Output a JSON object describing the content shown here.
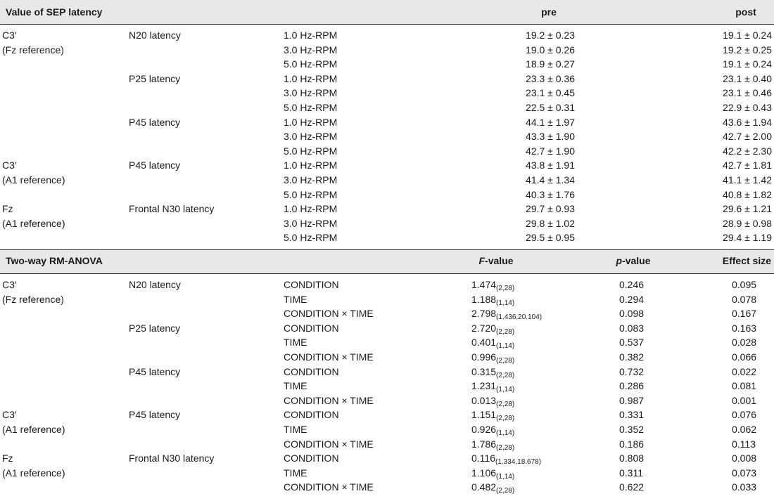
{
  "sep": {
    "title": "Value of SEP latency",
    "col_pre": "pre",
    "col_post": "post",
    "groups": [
      {
        "site1": "C3′",
        "site2": "(Fz reference)",
        "components": [
          {
            "name": "N20 latency",
            "rows": [
              {
                "freq": "1.0 Hz-RPM",
                "pre": "19.2 ± 0.23",
                "post": "19.1 ± 0.24"
              },
              {
                "freq": "3.0 Hz-RPM",
                "pre": "19.0 ± 0.26",
                "post": "19.2 ± 0.25"
              },
              {
                "freq": "5.0 Hz-RPM",
                "pre": "18.9 ± 0.27",
                "post": "19.1 ± 0.24"
              }
            ]
          },
          {
            "name": "P25 latency",
            "rows": [
              {
                "freq": "1.0 Hz-RPM",
                "pre": "23.3 ± 0.36",
                "post": "23.1 ± 0.40"
              },
              {
                "freq": "3.0 Hz-RPM",
                "pre": "23.1 ± 0.45",
                "post": "23.1 ± 0.46"
              },
              {
                "freq": "5.0 Hz-RPM",
                "pre": "22.5 ± 0.31",
                "post": "22.9 ± 0.43"
              }
            ]
          },
          {
            "name": "P45 latency",
            "rows": [
              {
                "freq": "1.0 Hz-RPM",
                "pre": "44.1 ± 1.97",
                "post": "43.6 ± 1.94"
              },
              {
                "freq": "3.0 Hz-RPM",
                "pre": "43.3 ± 1.90",
                "post": "42.7 ± 2.00"
              },
              {
                "freq": "5.0 Hz-RPM",
                "pre": "42.7 ± 1.90",
                "post": "42.2 ± 2.30"
              }
            ]
          }
        ]
      },
      {
        "site1": "C3′",
        "site2": "(A1 reference)",
        "components": [
          {
            "name": "P45 latency",
            "rows": [
              {
                "freq": "1.0 Hz-RPM",
                "pre": "43.8 ± 1.91",
                "post": "42.7 ± 1.81"
              },
              {
                "freq": "3.0 Hz-RPM",
                "pre": "41.4 ± 1.34",
                "post": "41.1 ± 1.42"
              },
              {
                "freq": "5.0 Hz-RPM",
                "pre": "40.3 ± 1.76",
                "post": "40.8 ± 1.82"
              }
            ]
          }
        ]
      },
      {
        "site1": "Fz",
        "site2": "(A1 reference)",
        "components": [
          {
            "name": "Frontal N30 latency",
            "rows": [
              {
                "freq": "1.0 Hz-RPM",
                "pre": "29.7 ± 0.93",
                "post": "29.6 ± 1.21"
              },
              {
                "freq": "3.0 Hz-RPM",
                "pre": "29.8 ± 1.02",
                "post": "28.9 ± 0.98"
              },
              {
                "freq": "5.0 Hz-RPM",
                "pre": "29.5 ± 0.95",
                "post": "29.4 ± 1.19"
              }
            ]
          }
        ]
      }
    ]
  },
  "anova": {
    "title": "Two-way RM-ANOVA",
    "col_f_italic": "F",
    "col_f_rest": "-value",
    "col_p_italic": "p",
    "col_p_rest": "-value",
    "col_effect": "Effect size",
    "groups": [
      {
        "site1": "C3′",
        "site2": "(Fz reference)",
        "components": [
          {
            "name": "N20 latency",
            "rows": [
              {
                "factor": "CONDITION",
                "f": "1.474",
                "df": "(2,28)",
                "p": "0.246",
                "es": "0.095"
              },
              {
                "factor": "TIME",
                "f": "1.188",
                "df": "(1,14)",
                "p": "0.294",
                "es": "0.078"
              },
              {
                "factor": "CONDITION × TIME",
                "f": "2.798",
                "df": "(1.436,20.104)",
                "p": "0.098",
                "es": "0.167"
              }
            ]
          },
          {
            "name": "P25 latency",
            "rows": [
              {
                "factor": "CONDITION",
                "f": "2.720",
                "df": "(2,28)",
                "p": "0.083",
                "es": "0.163"
              },
              {
                "factor": "TIME",
                "f": "0.401",
                "df": "(1,14)",
                "p": "0.537",
                "es": "0.028"
              },
              {
                "factor": "CONDITION × TIME",
                "f": "0.996",
                "df": "(2,28)",
                "p": "0.382",
                "es": "0.066"
              }
            ]
          },
          {
            "name": "P45 latency",
            "rows": [
              {
                "factor": "CONDITION",
                "f": "0.315",
                "df": "(2,28)",
                "p": "0.732",
                "es": "0.022"
              },
              {
                "factor": "TIME",
                "f": "1.231",
                "df": "(1,14)",
                "p": "0.286",
                "es": "0.081"
              },
              {
                "factor": "CONDITION × TIME",
                "f": "0.013",
                "df": "(2,28)",
                "p": "0.987",
                "es": "0.001"
              }
            ]
          }
        ]
      },
      {
        "site1": "C3′",
        "site2": "(A1 reference)",
        "components": [
          {
            "name": "P45 latency",
            "rows": [
              {
                "factor": "CONDITION",
                "f": "1.151",
                "df": "(2,28)",
                "p": "0.331",
                "es": "0.076"
              },
              {
                "factor": "TIME",
                "f": "0.926",
                "df": "(1,14)",
                "p": "0.352",
                "es": "0.062"
              },
              {
                "factor": "CONDITION × TIME",
                "f": "1.786",
                "df": "(2,28)",
                "p": "0.186",
                "es": "0.113"
              }
            ]
          }
        ]
      },
      {
        "site1": "Fz",
        "site2": "(A1 reference)",
        "components": [
          {
            "name": "Frontal N30 latency",
            "rows": [
              {
                "factor": "CONDITION",
                "f": "0.116",
                "df": "(1.334,18.678)",
                "p": "0.808",
                "es": "0.008"
              },
              {
                "factor": "TIME",
                "f": "1.106",
                "df": "(1,14)",
                "p": "0.311",
                "es": "0.073"
              },
              {
                "factor": "CONDITION × TIME",
                "f": "0.482",
                "df": "(2,28)",
                "p": "0.622",
                "es": "0.033"
              }
            ]
          }
        ]
      }
    ]
  }
}
